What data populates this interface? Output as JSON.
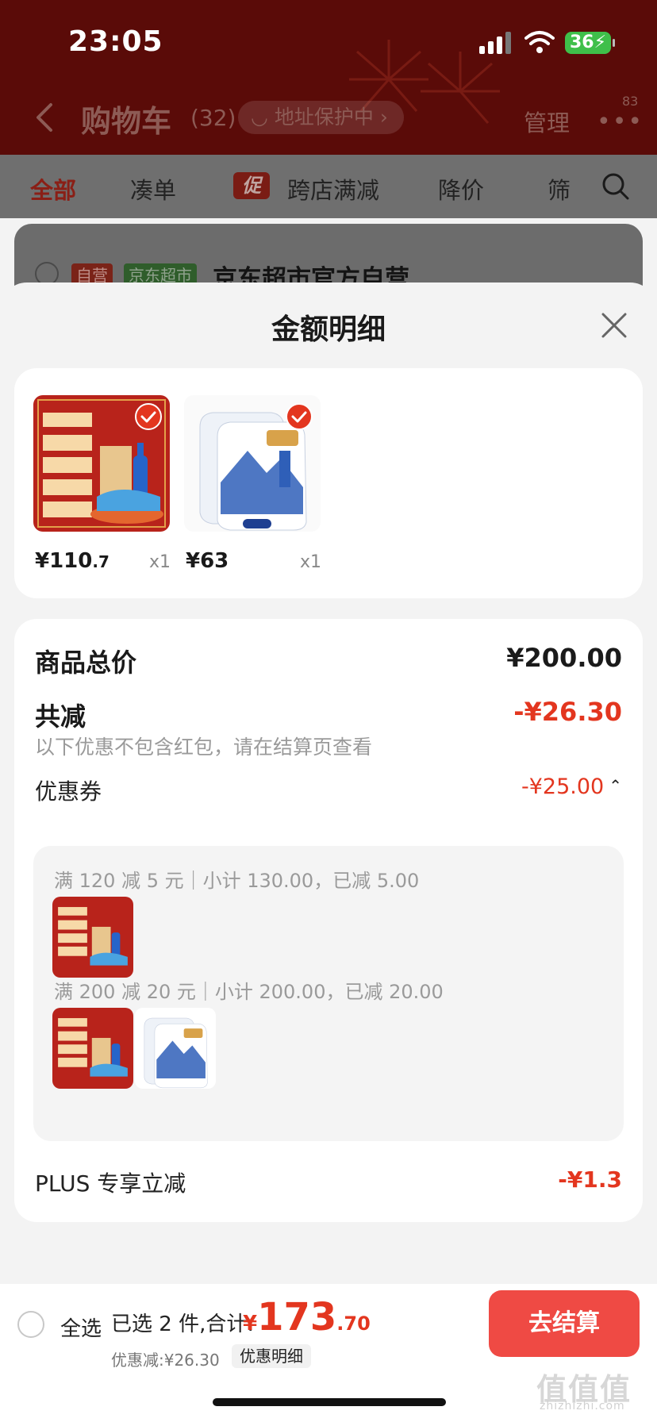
{
  "status_bar": {
    "time": "23:05",
    "battery": "36"
  },
  "nav": {
    "title": "购物车",
    "count": "(32)",
    "address_protect": "地址保护中",
    "manage": "管理",
    "badge": "83"
  },
  "filters": {
    "all": "全部",
    "combine": "凑单",
    "promo_tag": "促",
    "cross_store": "跨店满减",
    "price_drop": "降价",
    "filter": "筛"
  },
  "store": {
    "tag_self": "自营",
    "tag_market": "京东超市",
    "name": "京东超市官方自营"
  },
  "sheet": {
    "title": "金额明细",
    "items": [
      {
        "price_int": "¥110",
        "price_dec": ".7",
        "qty": "x1"
      },
      {
        "price_int": "¥63",
        "price_dec": "",
        "qty": "x1"
      }
    ],
    "total_goods_label": "商品总价",
    "total_goods_value": "¥200.00",
    "discount_label": "共减",
    "discount_value": "-¥26.30",
    "discount_note": "以下优惠不包含红包，请在结算页查看",
    "coupon_label": "优惠券",
    "coupon_value": "-¥25.00",
    "coupon_rules": [
      "满 120 减 5 元｜小计 130.00，已减 5.00",
      "满 200 减 20 元｜小计 200.00，已减 20.00"
    ],
    "plus_label": "PLUS 专享立减",
    "plus_value": "-¥1.3"
  },
  "bottom_bar": {
    "select_all": "全选",
    "selected_text": "已选 2 件,合计:",
    "total_currency": "¥",
    "total_int": "173",
    "total_dec": ".70",
    "discount_note": "优惠减:¥26.30",
    "detail_link": "优惠明细",
    "checkout": "去结算"
  },
  "watermark": {
    "main": "值值值",
    "sub": "zhizhizhi.com"
  },
  "colors": {
    "accent_red": "#e3361f",
    "checkout_red": "#ef4a44",
    "header_dark": "#5a0b08"
  }
}
